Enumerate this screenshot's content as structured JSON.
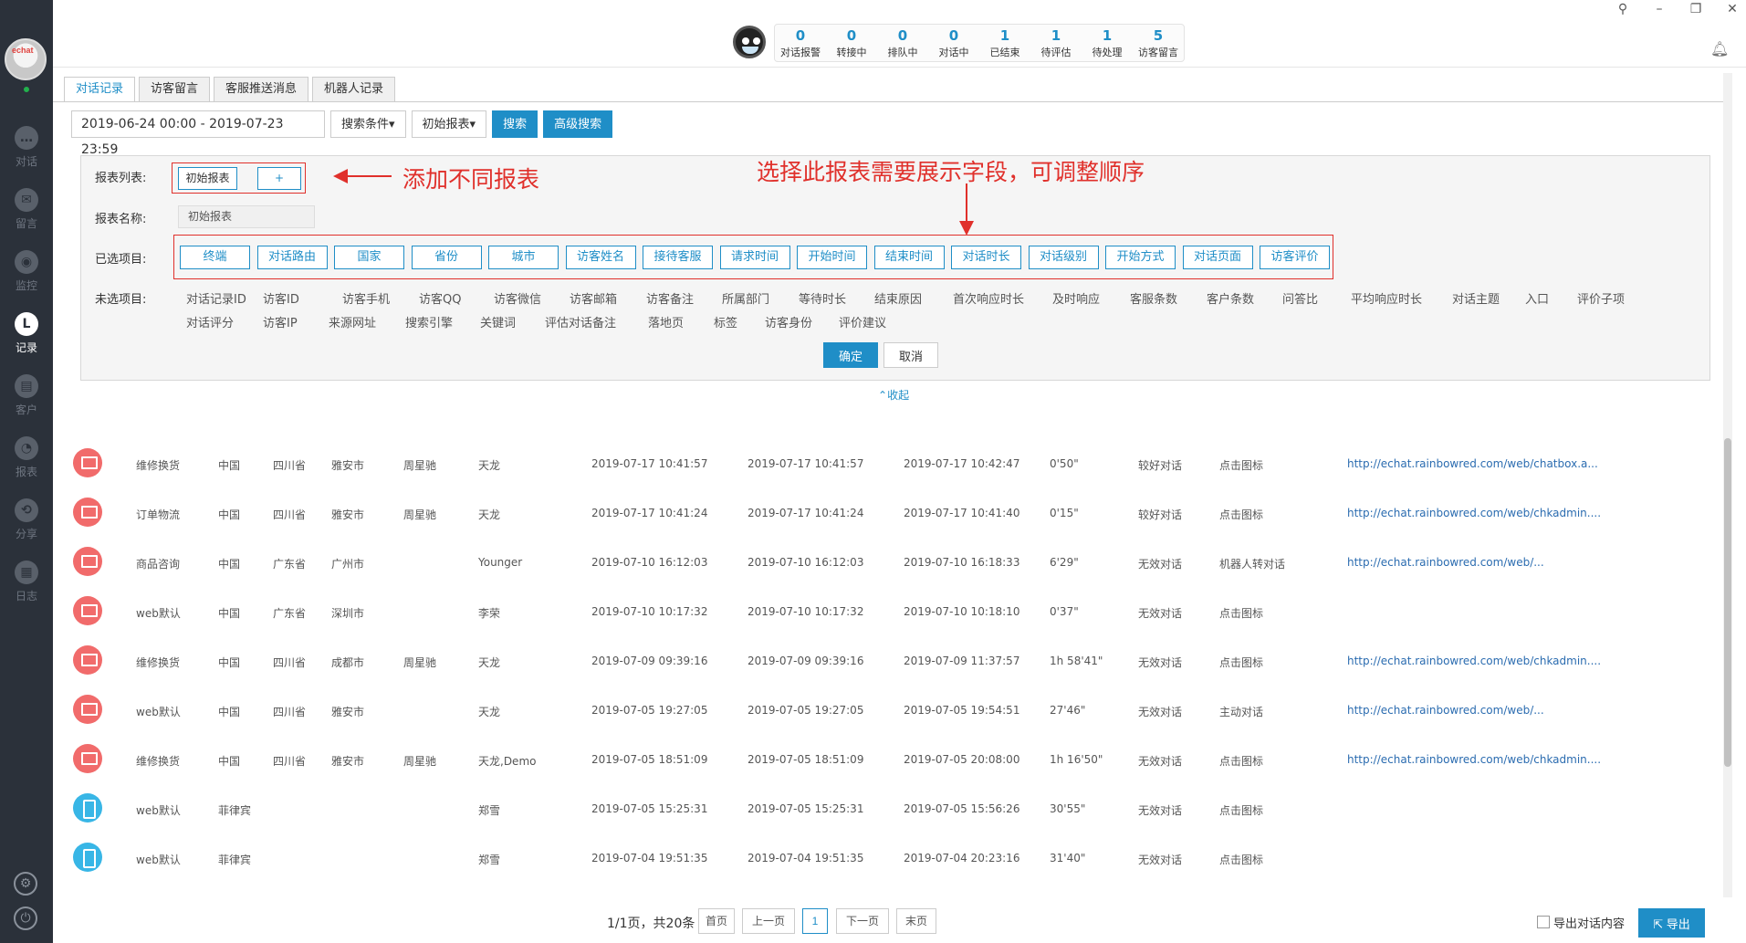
{
  "sidebar": {
    "logo_text": "echat",
    "items": [
      {
        "label": "对话",
        "icon": "chat-bubble-icon"
      },
      {
        "label": "留言",
        "icon": "mail-icon"
      },
      {
        "label": "监控",
        "icon": "eye-icon"
      },
      {
        "label": "记录",
        "icon": "clock-icon",
        "active": true
      },
      {
        "label": "客户",
        "icon": "contact-card-icon"
      },
      {
        "label": "报表",
        "icon": "pie-chart-icon"
      },
      {
        "label": "分享",
        "icon": "share-icon"
      },
      {
        "label": "日志",
        "icon": "clipboard-icon"
      }
    ],
    "bottom_icons": [
      "settings-icon",
      "power-icon"
    ]
  },
  "stats": [
    {
      "num": "0",
      "name": "对话报警"
    },
    {
      "num": "0",
      "name": "转接中"
    },
    {
      "num": "0",
      "name": "排队中"
    },
    {
      "num": "0",
      "name": "对话中"
    },
    {
      "num": "1",
      "name": "已结束"
    },
    {
      "num": "1",
      "name": "待评估"
    },
    {
      "num": "1",
      "name": "待处理"
    },
    {
      "num": "5",
      "name": "访客留言"
    }
  ],
  "tabs": [
    {
      "label": "对话记录",
      "active": true
    },
    {
      "label": "访客留言"
    },
    {
      "label": "客服推送消息"
    },
    {
      "label": "机器人记录"
    }
  ],
  "search": {
    "date_range": "2019-06-24 00:00  -  2019-07-23 23:59",
    "conditions_label": "搜索条件▾",
    "report_label": "初始报表▾",
    "search_label": "搜索",
    "advanced_label": "高级搜索"
  },
  "panel": {
    "report_list_label": "报表列表:",
    "report_items": [
      "初始报表",
      "+"
    ],
    "report_name_label": "报表名称:",
    "report_name_value": "初始报表",
    "selected_label": "已选项目:",
    "selected_fields": [
      "终端",
      "对话路由",
      "国家",
      "省份",
      "城市",
      "访客姓名",
      "接待客服",
      "请求时间",
      "开始时间",
      "结束时间",
      "对话时长",
      "对话级别",
      "开始方式",
      "对话页面",
      "访客评价"
    ],
    "unselected_label": "未选项目:",
    "unselected_row1": [
      "对话记录ID",
      "访客ID",
      "访客手机",
      "访客QQ",
      "访客微信",
      "访客邮箱",
      "访客备注",
      "所属部门",
      "等待时长",
      "结束原因",
      "首次响应时长",
      "及时响应",
      "客服条数",
      "客户条数",
      "问答比",
      "平均响应时长",
      "对话主题",
      "入口",
      "评价子项"
    ],
    "unselected_row2": [
      "对话评分",
      "访客IP",
      "来源网址",
      "搜索引擎",
      "关键词",
      "评估对话备注",
      "落地页",
      "标签",
      "访客身份",
      "评价建议"
    ],
    "ok_label": "确定",
    "cancel_label": "取消",
    "annotation_left": "添加不同报表",
    "annotation_top": "选择此报表需要展示字段，可调整顺序",
    "collapse_label": "收起"
  },
  "table_rows": [
    {
      "device": "pc",
      "route": "维修换货",
      "country": "中国",
      "province": "四川省",
      "city": "雅安市",
      "agent": "周星驰",
      "visitor": "天龙",
      "request": "2019-07-17 10:41:57",
      "start": "2019-07-17 10:41:57",
      "end": "2019-07-17 10:42:47",
      "duration": "0'50\"",
      "level": "较好对话",
      "mode": "点击图标",
      "page": "http://echat.rainbowred.com/web/chatbox.a..."
    },
    {
      "device": "pc",
      "route": "订单物流",
      "country": "中国",
      "province": "四川省",
      "city": "雅安市",
      "agent": "周星驰",
      "visitor": "天龙",
      "request": "2019-07-17 10:41:24",
      "start": "2019-07-17 10:41:24",
      "end": "2019-07-17 10:41:40",
      "duration": "0'15\"",
      "level": "较好对话",
      "mode": "点击图标",
      "page": "http://echat.rainbowred.com/web/chkadmin...."
    },
    {
      "device": "pc",
      "route": "商品咨询",
      "country": "中国",
      "province": "广东省",
      "city": "广州市",
      "agent": "",
      "visitor": "Younger",
      "request": "2019-07-10 16:12:03",
      "start": "2019-07-10 16:12:03",
      "end": "2019-07-10 16:18:33",
      "duration": "6'29\"",
      "level": "无效对话",
      "mode": "机器人转对话",
      "page": "http://echat.rainbowred.com/web/..."
    },
    {
      "device": "pc",
      "route": "web默认",
      "country": "中国",
      "province": "广东省",
      "city": "深圳市",
      "agent": "",
      "visitor": "李荣",
      "request": "2019-07-10 10:17:32",
      "start": "2019-07-10 10:17:32",
      "end": "2019-07-10 10:18:10",
      "duration": "0'37\"",
      "level": "无效对话",
      "mode": "点击图标",
      "page": ""
    },
    {
      "device": "pc",
      "route": "维修换货",
      "country": "中国",
      "province": "四川省",
      "city": "成都市",
      "agent": "周星驰",
      "visitor": "天龙",
      "request": "2019-07-09 09:39:16",
      "start": "2019-07-09 09:39:16",
      "end": "2019-07-09 11:37:57",
      "duration": "1h 58'41\"",
      "level": "无效对话",
      "mode": "点击图标",
      "page": "http://echat.rainbowred.com/web/chkadmin...."
    },
    {
      "device": "pc",
      "route": "web默认",
      "country": "中国",
      "province": "四川省",
      "city": "雅安市",
      "agent": "",
      "visitor": "天龙",
      "request": "2019-07-05 19:27:05",
      "start": "2019-07-05 19:27:05",
      "end": "2019-07-05 19:54:51",
      "duration": "27'46\"",
      "level": "无效对话",
      "mode": "主动对话",
      "page": "http://echat.rainbowred.com/web/..."
    },
    {
      "device": "pc",
      "route": "维修换货",
      "country": "中国",
      "province": "四川省",
      "city": "雅安市",
      "agent": "周星驰",
      "visitor": "天龙,Demo",
      "request": "2019-07-05 18:51:09",
      "start": "2019-07-05 18:51:09",
      "end": "2019-07-05 20:08:00",
      "duration": "1h 16'50\"",
      "level": "无效对话",
      "mode": "点击图标",
      "page": "http://echat.rainbowred.com/web/chkadmin...."
    },
    {
      "device": "mb",
      "route": "web默认",
      "country": "菲律宾",
      "province": "",
      "city": "",
      "agent": "",
      "visitor": "郑雪",
      "request": "2019-07-05 15:25:31",
      "start": "2019-07-05 15:25:31",
      "end": "2019-07-05 15:56:26",
      "duration": "30'55\"",
      "level": "无效对话",
      "mode": "点击图标",
      "page": ""
    },
    {
      "device": "mb",
      "route": "web默认",
      "country": "菲律宾",
      "province": "",
      "city": "",
      "agent": "",
      "visitor": "郑雪",
      "request": "2019-07-04 19:51:35",
      "start": "2019-07-04 19:51:35",
      "end": "2019-07-04 20:23:16",
      "duration": "31'40\"",
      "level": "无效对话",
      "mode": "点击图标",
      "page": ""
    }
  ],
  "pagination": {
    "info": "1/1页，共20条",
    "first": "首页",
    "prev": "上一页",
    "current": "1",
    "next": "下一页",
    "last": "末页"
  },
  "export": {
    "checkbox_label": "导出对话内容",
    "button_label": "导出"
  },
  "colors": {
    "accent": "#1f8ec7",
    "sidebar_bg": "#2b313a",
    "annotation_red": "#e0302b",
    "pc_icon": "#f16b6b",
    "mobile_icon": "#38b6e6"
  }
}
